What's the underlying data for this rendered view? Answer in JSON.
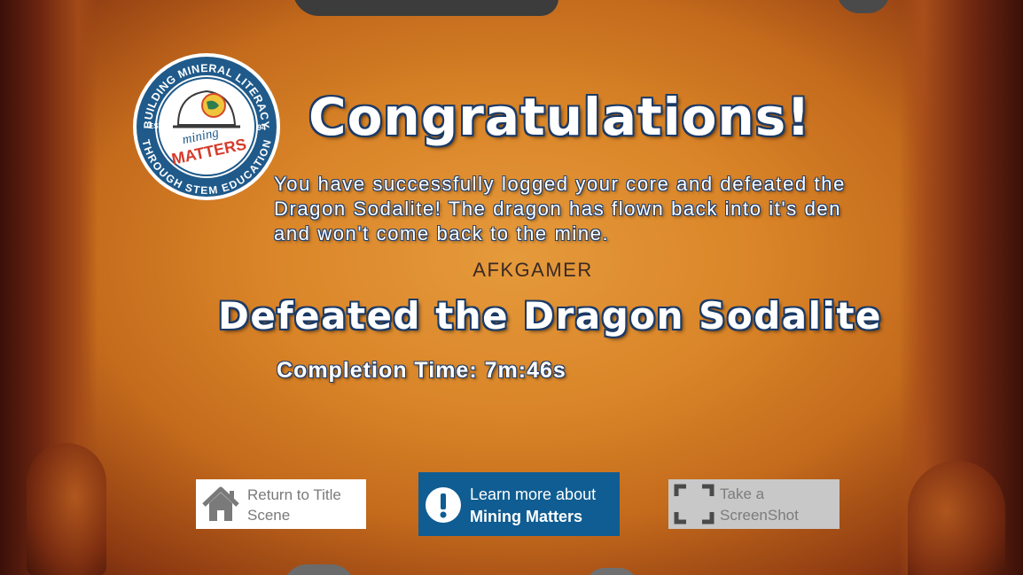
{
  "logo": {
    "top_arc": "BUILDING MINERAL LITERACY",
    "bottom_arc": "THROUGH STEM EDUCATION",
    "est": "EST.",
    "year": "94",
    "word1": "mining",
    "word2": "MATTERS"
  },
  "title": "Congratulations!",
  "message": "You have successfully logged your core and defeated the Dragon Sodalite! The dragon has flown back into it's den and won't come back to the mine.",
  "player_name": "AFKGAMER",
  "achievement": "Defeated the Dragon Sodalite",
  "completion": {
    "label": "Completion Time:",
    "value": "7m:46s"
  },
  "buttons": {
    "return": {
      "line1": "Return to Title",
      "line2": "Scene",
      "icon": "home-icon"
    },
    "learn": {
      "line1": "Learn more about",
      "line2": "Mining Matters",
      "icon": "exclamation-icon"
    },
    "screenshot": {
      "line1": "Take a",
      "line2": "ScreenShot",
      "icon": "screenshot-frame-icon"
    }
  },
  "colors": {
    "outline": "#1b3a66",
    "learn_button": "#0f5d92",
    "logo_ring": "#1f5a8a",
    "parchment": "#d98428"
  }
}
